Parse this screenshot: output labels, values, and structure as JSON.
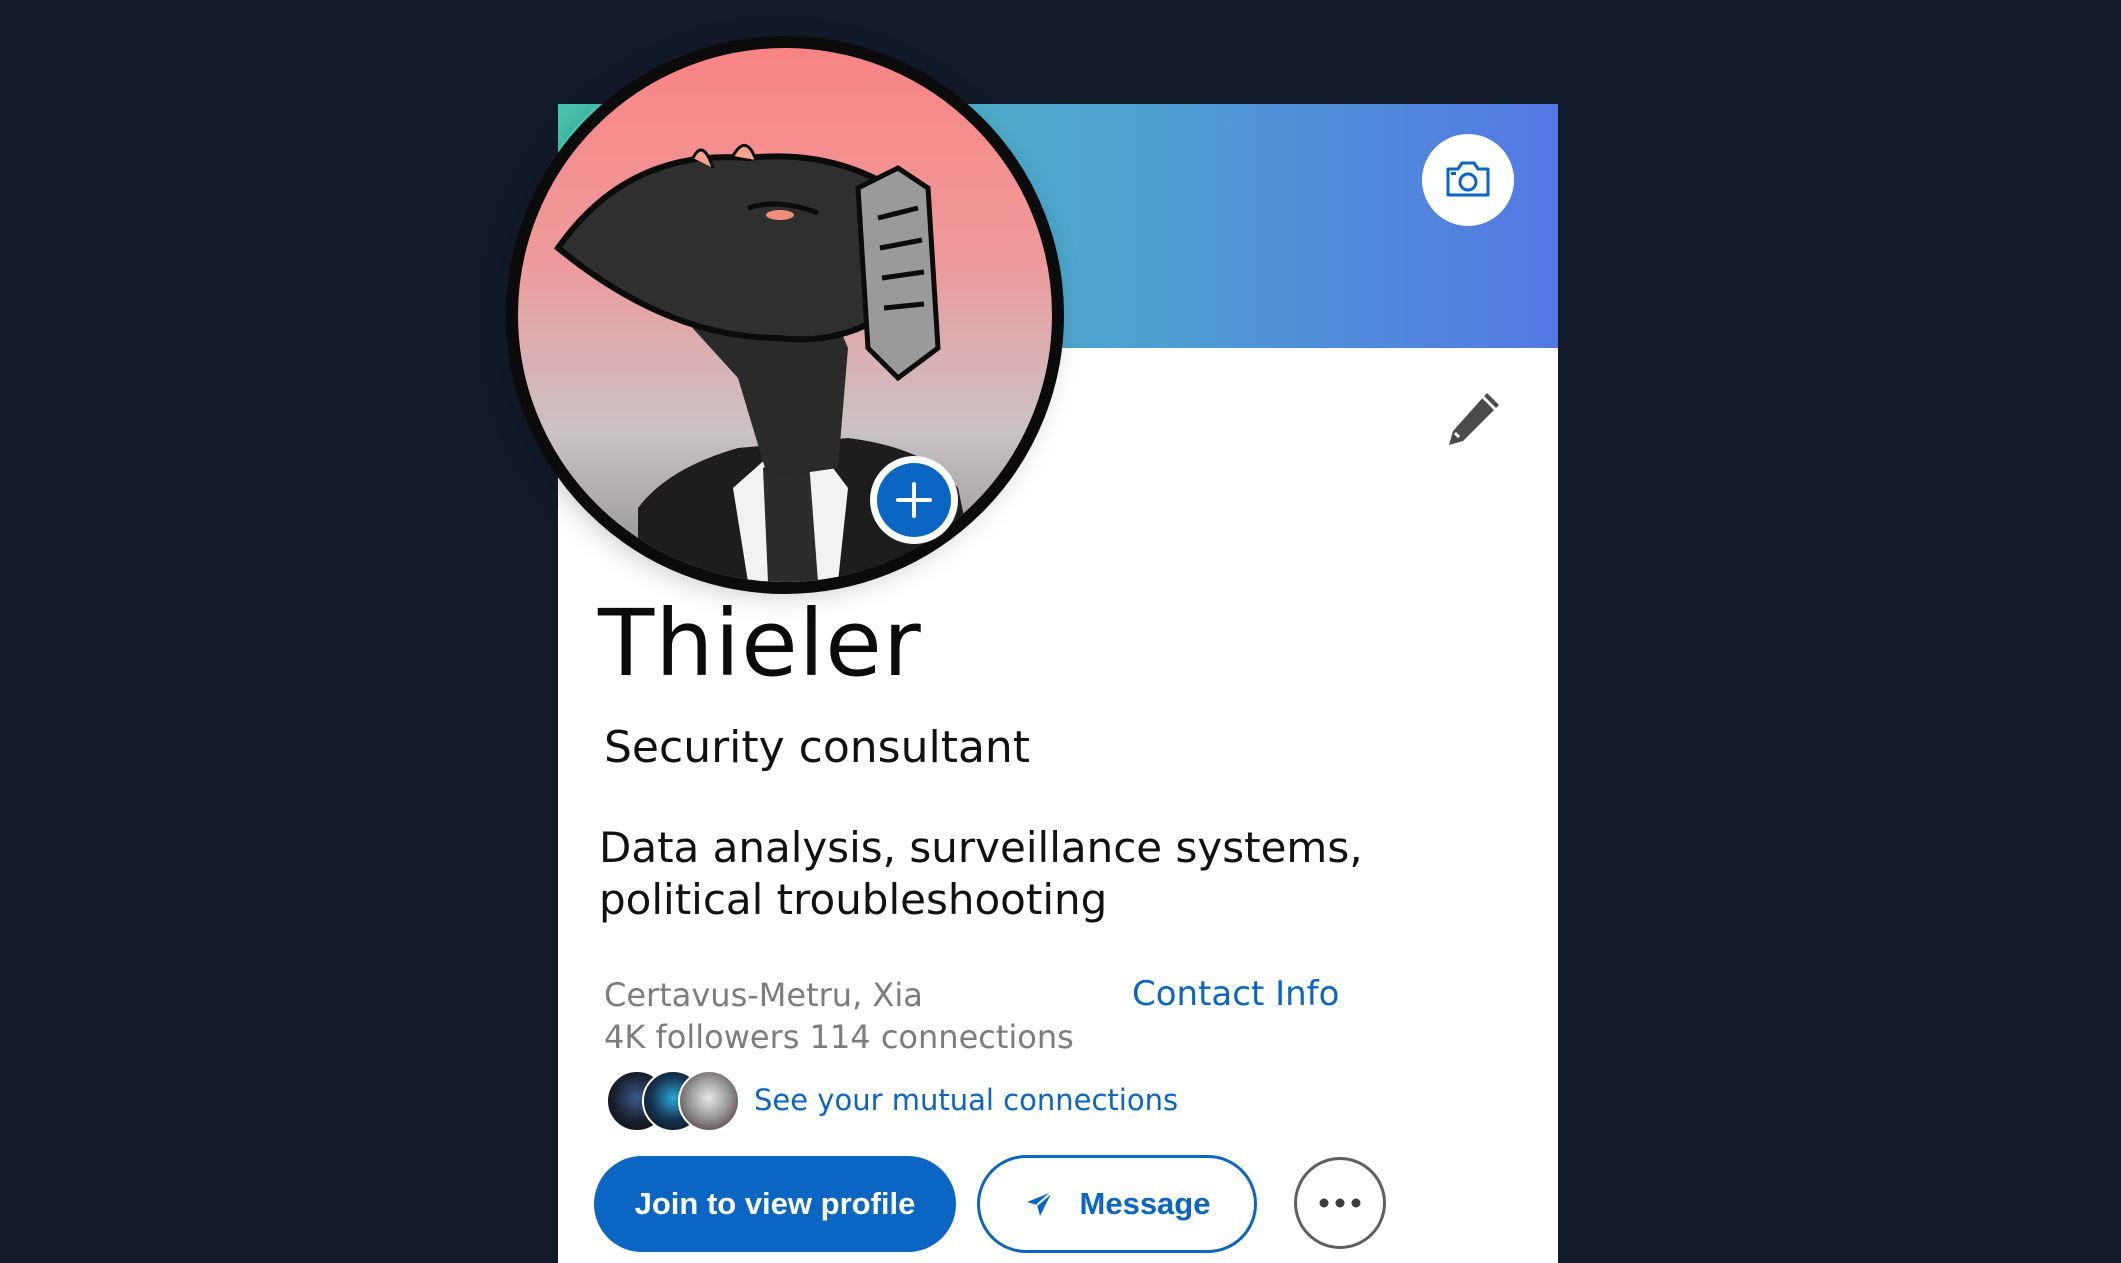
{
  "profile": {
    "name": "Thieler",
    "headline": "Security consultant",
    "summary": "Data analysis, surveillance systems, political troubleshooting",
    "location": "Certavus-Metru, Xia",
    "stats": "4K followers 114 connections",
    "contact_info_label": "Contact Info",
    "mutual_connections_label": "See your mutual connections"
  },
  "actions": {
    "join_label": "Join to view profile",
    "message_label": "Message"
  },
  "icons": {
    "banner_camera": "camera-icon",
    "edit": "pencil-icon",
    "add_photo": "plus-icon",
    "message": "send-icon",
    "more": "more-dots-icon"
  },
  "colors": {
    "page_background": "#121a2a",
    "brand_blue": "#0a66c2",
    "banner_start": "#47c4ad",
    "banner_end": "#5378e4",
    "secondary_text": "#7c7c7c"
  }
}
